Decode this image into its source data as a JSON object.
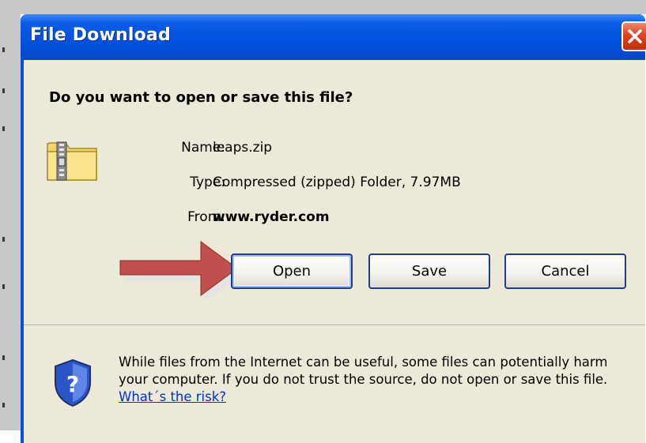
{
  "window": {
    "title": "File Download"
  },
  "prompt": {
    "question": "Do you want to open or save this file?"
  },
  "file": {
    "name_label": "Name:",
    "name": "leaps.zip",
    "type_label": "Type:",
    "type": "Compressed (zipped) Folder, 7.97MB",
    "from_label": "From:",
    "from": "www.ryder.com",
    "icon": "zip-folder-icon"
  },
  "buttons": {
    "open": "Open",
    "save": "Save",
    "cancel": "Cancel"
  },
  "warning": {
    "text": "While files from the Internet can be useful, some files can potentially harm your computer. If you do not trust the source, do not open or save this file. ",
    "link": "What´s the risk?",
    "icon": "security-shield-icon"
  },
  "annotation": {
    "icon": "red-arrow-pointer"
  },
  "colors": {
    "titlebar": "#0a5be6",
    "client_background": "#ece9d8",
    "close_button": "#d9451f",
    "arrow": "#c0504d",
    "link": "#0033cc"
  }
}
